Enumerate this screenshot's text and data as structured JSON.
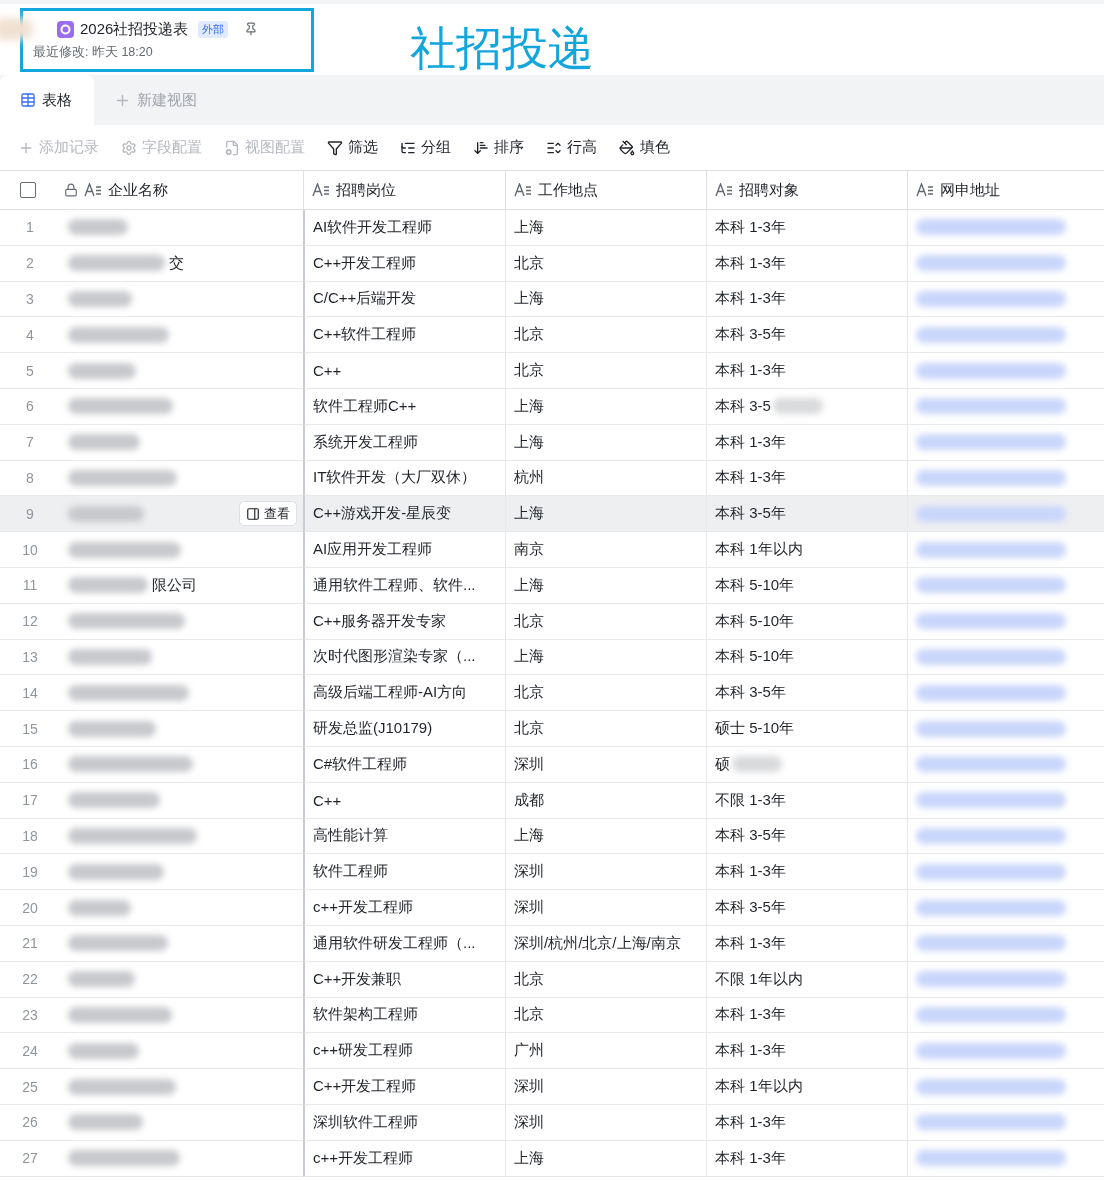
{
  "document": {
    "title": "2026社招投递表",
    "badge": "外部",
    "modified": "最近修改: 昨天 18:20",
    "owner_redacted": true
  },
  "annotation": {
    "text": "社招投递",
    "highlight_title": true
  },
  "tabs": [
    {
      "label": "表格",
      "selected": true,
      "kind": "view"
    },
    {
      "label": "新建视图",
      "selected": false,
      "kind": "add"
    }
  ],
  "toolbar": [
    {
      "label": "添加记录",
      "disabled": true
    },
    {
      "label": "字段配置",
      "disabled": true
    },
    {
      "label": "视图配置",
      "disabled": true
    },
    {
      "label": "筛选",
      "disabled": false
    },
    {
      "label": "分组",
      "disabled": false
    },
    {
      "label": "排序",
      "disabled": false
    },
    {
      "label": "行高",
      "disabled": false
    },
    {
      "label": "填色",
      "disabled": false
    }
  ],
  "table": {
    "select_all": {
      "checked": false
    },
    "columns": [
      {
        "label": "企业名称",
        "locked": true
      },
      {
        "label": "招聘岗位",
        "locked": false
      },
      {
        "label": "工作地点",
        "locked": false
      },
      {
        "label": "招聘对象",
        "locked": false
      },
      {
        "label": "网申地址",
        "locked": false
      }
    ],
    "rows": [
      {
        "number": "1",
        "company_redacted": true,
        "position": "AI软件开发工程师",
        "location": "上海",
        "target": "本科 1-3年",
        "target_redacted": false,
        "url_redacted": true,
        "hovered": false
      },
      {
        "number": "2",
        "company_redacted": true,
        "company_fragment": "交",
        "position": "C++开发工程师",
        "location": "北京",
        "target": "本科 1-3年",
        "target_redacted": false,
        "url_redacted": true,
        "hovered": false
      },
      {
        "number": "3",
        "company_redacted": true,
        "position": "C/C++后端开发",
        "location": "上海",
        "target": "本科 1-3年",
        "target_redacted": false,
        "url_redacted": true,
        "hovered": false
      },
      {
        "number": "4",
        "company_redacted": true,
        "position": "C++软件工程师",
        "location": "北京",
        "target": "本科 3-5年",
        "target_redacted": false,
        "url_redacted": true,
        "hovered": false
      },
      {
        "number": "5",
        "company_redacted": true,
        "position": "C++",
        "location": "北京",
        "target": "本科 1-3年",
        "target_redacted": false,
        "url_redacted": true,
        "hovered": false
      },
      {
        "number": "6",
        "company_redacted": true,
        "position": "软件工程师C++",
        "location": "上海",
        "target": "本科 3-5",
        "target_redacted": true,
        "url_redacted": true,
        "hovered": false
      },
      {
        "number": "7",
        "company_redacted": true,
        "position": "系统开发工程师",
        "location": "上海",
        "target": "本科 1-3年",
        "target_redacted": false,
        "url_redacted": true,
        "hovered": false
      },
      {
        "number": "8",
        "company_redacted": true,
        "position": "IT软件开发（大厂双休）",
        "location": "杭州",
        "target": "本科 1-3年",
        "target_redacted": false,
        "url_redacted": true,
        "hovered": false
      },
      {
        "number": "9",
        "company_redacted": true,
        "position": "C++游戏开发-星辰变",
        "location": "上海",
        "target": "本科 3-5年",
        "target_redacted": false,
        "url_redacted": true,
        "hovered": true,
        "view_label": "查看"
      },
      {
        "number": "10",
        "company_redacted": true,
        "position": "AI应用开发工程师",
        "location": "南京",
        "target": "本科 1年以内",
        "target_redacted": false,
        "url_redacted": true,
        "hovered": false
      },
      {
        "number": "11",
        "company_redacted": true,
        "company_fragment": "限公司",
        "position": "通用软件工程师、软件...",
        "location": "上海",
        "target": "本科 5-10年",
        "target_redacted": false,
        "url_redacted": true,
        "hovered": false
      },
      {
        "number": "12",
        "company_redacted": true,
        "position": "C++服务器开发专家",
        "location": "北京",
        "target": "本科 5-10年",
        "target_redacted": false,
        "url_redacted": true,
        "hovered": false
      },
      {
        "number": "13",
        "company_redacted": true,
        "position": "次时代图形渲染专家（...",
        "location": "上海",
        "target": "本科 5-10年",
        "target_redacted": false,
        "url_redacted": true,
        "hovered": false
      },
      {
        "number": "14",
        "company_redacted": true,
        "position": "高级后端工程师-AI方向",
        "location": "北京",
        "target": "本科 3-5年",
        "target_redacted": false,
        "url_redacted": true,
        "hovered": false
      },
      {
        "number": "15",
        "company_redacted": true,
        "position": "研发总监(J10179)",
        "location": "北京",
        "target": "硕士 5-10年",
        "target_redacted": false,
        "url_redacted": true,
        "hovered": false
      },
      {
        "number": "16",
        "company_redacted": true,
        "position": "C#软件工程师",
        "location": "深圳",
        "target": "硕",
        "target_redacted": true,
        "url_redacted": true,
        "hovered": false
      },
      {
        "number": "17",
        "company_redacted": true,
        "position": "C++",
        "location": "成都",
        "target": "不限 1-3年",
        "target_redacted": false,
        "url_redacted": true,
        "hovered": false
      },
      {
        "number": "18",
        "company_redacted": true,
        "position": "高性能计算",
        "location": "上海",
        "target": "本科 3-5年",
        "target_redacted": false,
        "url_redacted": true,
        "hovered": false
      },
      {
        "number": "19",
        "company_redacted": true,
        "position": "软件工程师",
        "location": "深圳",
        "target": "本科 1-3年",
        "target_redacted": false,
        "url_redacted": true,
        "hovered": false
      },
      {
        "number": "20",
        "company_redacted": true,
        "position": "c++开发工程师",
        "location": "深圳",
        "target": "本科 3-5年",
        "target_redacted": false,
        "url_redacted": true,
        "hovered": false
      },
      {
        "number": "21",
        "company_redacted": true,
        "position": "通用软件研发工程师（...",
        "location": "深圳/杭州/北京/上海/南京",
        "target": "本科 1-3年",
        "target_redacted": false,
        "url_redacted": true,
        "hovered": false
      },
      {
        "number": "22",
        "company_redacted": true,
        "position": "C++开发兼职",
        "location": "北京",
        "target": "不限 1年以内",
        "target_redacted": false,
        "url_redacted": true,
        "hovered": false
      },
      {
        "number": "23",
        "company_redacted": true,
        "position": "软件架构工程师",
        "location": "北京",
        "target": "本科 1-3年",
        "target_redacted": false,
        "url_redacted": true,
        "hovered": false
      },
      {
        "number": "24",
        "company_redacted": true,
        "position": "c++研发工程师",
        "location": "广州",
        "target": "本科 1-3年",
        "target_redacted": false,
        "url_redacted": true,
        "hovered": false
      },
      {
        "number": "25",
        "company_redacted": true,
        "position": "C++开发工程师",
        "location": "深圳",
        "target": "本科 1年以内",
        "target_redacted": false,
        "url_redacted": true,
        "hovered": false
      },
      {
        "number": "26",
        "company_redacted": true,
        "position": "深圳软件工程师",
        "location": "深圳",
        "target": "本科 1-3年",
        "target_redacted": false,
        "url_redacted": true,
        "hovered": false
      },
      {
        "number": "27",
        "company_redacted": true,
        "position": "c++开发工程师",
        "location": "上海",
        "target": "本科 1-3年",
        "target_redacted": false,
        "url_redacted": true,
        "hovered": false
      }
    ]
  }
}
